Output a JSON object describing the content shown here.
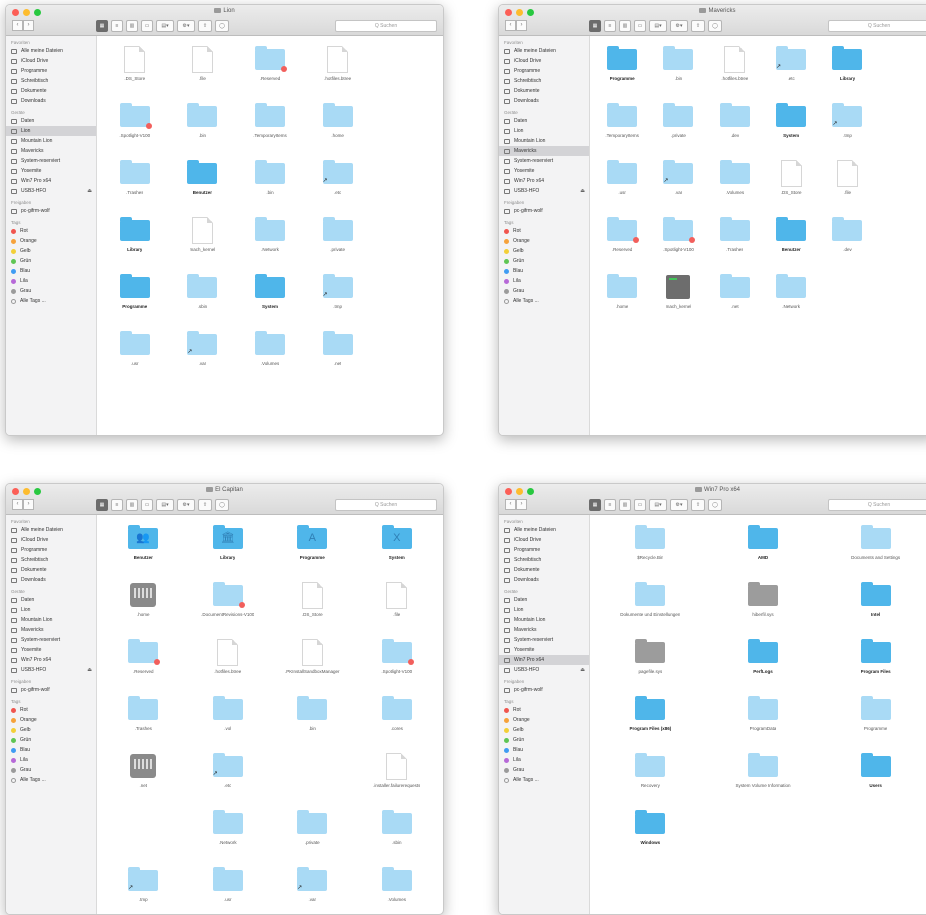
{
  "common": {
    "search_placeholder": "Q Suchen",
    "sidebar": {
      "favorites_title": "Favoriten",
      "favorites": [
        "Alle meine Dateien",
        "iCloud Drive",
        "Programme",
        "Schreibtisch",
        "Dokumente",
        "Downloads"
      ],
      "devices_title": "Geräte",
      "devices": [
        "Daten",
        "Lion",
        "Mountain Lion",
        "Mavericks",
        "System-reserviert",
        "Yosemite",
        "Win7 Pro x64",
        "USB3-HFO"
      ],
      "shared_title": "Freigaben",
      "shared": [
        "pc-gifrm-wolf"
      ],
      "tags_title": "Tags",
      "tags": [
        {
          "label": "Rot",
          "color": "#f0554e"
        },
        {
          "label": "Orange",
          "color": "#f6a23b"
        },
        {
          "label": "Gelb",
          "color": "#f3cf37"
        },
        {
          "label": "Grün",
          "color": "#5fc553"
        },
        {
          "label": "Blau",
          "color": "#3f9cf3"
        },
        {
          "label": "Lila",
          "color": "#b769d8"
        },
        {
          "label": "Grau",
          "color": "#9b9b9b"
        },
        {
          "label": "Alle Tags ...",
          "color": ""
        }
      ]
    }
  },
  "windows": [
    {
      "title": "Lion",
      "active_device": 1,
      "columns": 5,
      "items": [
        {
          "label": ".DS_Store",
          "icon": "file"
        },
        {
          "label": ".file",
          "icon": "file"
        },
        {
          "label": ".Reserved",
          "icon": "folder",
          "badge": "red"
        },
        {
          "label": ".hotfiles.btree",
          "icon": "file"
        },
        {
          "label": "",
          "icon": "none"
        },
        {
          "label": ".Spotlight-V100",
          "icon": "folder",
          "badge": "red"
        },
        {
          "label": ".bin",
          "icon": "folder"
        },
        {
          "label": ".TemporaryItems",
          "icon": "folder"
        },
        {
          "label": ".home",
          "icon": "folder"
        },
        {
          "label": "",
          "icon": "none"
        },
        {
          "label": ".Trashes",
          "icon": "folder"
        },
        {
          "label": "Benutzer",
          "icon": "folder-dark",
          "bold": true
        },
        {
          "label": ".bin",
          "icon": "folder"
        },
        {
          "label": ".etc",
          "icon": "folder",
          "badge": "alias"
        },
        {
          "label": "",
          "icon": "none"
        },
        {
          "label": "Library",
          "icon": "folder-dark",
          "bold": true
        },
        {
          "label": "mach_kernel",
          "icon": "file"
        },
        {
          "label": ".Network",
          "icon": "folder"
        },
        {
          "label": ".private",
          "icon": "folder"
        },
        {
          "label": "",
          "icon": "none"
        },
        {
          "label": "Programme",
          "icon": "folder-dark",
          "bold": true
        },
        {
          "label": ".sbin",
          "icon": "folder"
        },
        {
          "label": "System",
          "icon": "folder-dark",
          "bold": true
        },
        {
          "label": ".tmp",
          "icon": "folder",
          "badge": "alias"
        },
        {
          "label": "",
          "icon": "none"
        },
        {
          "label": ".usr",
          "icon": "folder"
        },
        {
          "label": ".var",
          "icon": "folder",
          "badge": "alias"
        },
        {
          "label": ".Volumes",
          "icon": "folder"
        },
        {
          "label": ".net",
          "icon": "folder"
        }
      ]
    },
    {
      "title": "Mavericks",
      "active_device": 3,
      "columns": 6,
      "items": [
        {
          "label": "Programme",
          "icon": "folder-dark",
          "bold": true
        },
        {
          "label": ".bin",
          "icon": "folder"
        },
        {
          "label": ".hotfiles.btree",
          "icon": "file"
        },
        {
          "label": ".etc",
          "icon": "folder",
          "badge": "alias"
        },
        {
          "label": "Library",
          "icon": "folder-dark",
          "bold": true
        },
        {
          "label": "",
          "icon": "none"
        },
        {
          "label": ".TemporaryItems",
          "icon": "folder"
        },
        {
          "label": ".private",
          "icon": "folder"
        },
        {
          "label": ".dev",
          "icon": "folder"
        },
        {
          "label": "System",
          "icon": "folder-dark",
          "bold": true
        },
        {
          "label": ".tmp",
          "icon": "folder",
          "badge": "alias"
        },
        {
          "label": "",
          "icon": "none"
        },
        {
          "label": ".usr",
          "icon": "folder"
        },
        {
          "label": ".var",
          "icon": "folder",
          "badge": "alias"
        },
        {
          "label": ".Volumes",
          "icon": "folder"
        },
        {
          "label": ".DS_Store",
          "icon": "file"
        },
        {
          "label": ".file",
          "icon": "file"
        },
        {
          "label": "",
          "icon": "none"
        },
        {
          "label": ".Reserved",
          "icon": "folder",
          "badge": "red"
        },
        {
          "label": ".Spotlight-V100",
          "icon": "folder",
          "badge": "red"
        },
        {
          "label": ".Trashes",
          "icon": "folder"
        },
        {
          "label": "Benutzer",
          "icon": "folder-dark",
          "bold": true
        },
        {
          "label": ".dev",
          "icon": "folder"
        },
        {
          "label": "",
          "icon": "none"
        },
        {
          "label": ".home",
          "icon": "folder"
        },
        {
          "label": "mach_kernel",
          "icon": "app"
        },
        {
          "label": ".net",
          "icon": "folder"
        },
        {
          "label": ".Network",
          "icon": "folder"
        }
      ]
    },
    {
      "title": "El Capitan",
      "active_device": -1,
      "columns": 4,
      "items": [
        {
          "label": "Benutzer",
          "icon": "folder-dark",
          "glyph": "👥",
          "bold": true
        },
        {
          "label": "Library",
          "icon": "folder-dark",
          "glyph": "🏛",
          "bold": true
        },
        {
          "label": "Programme",
          "icon": "folder-dark",
          "glyph": "A",
          "bold": true
        },
        {
          "label": "System",
          "icon": "folder-dark",
          "glyph": "X",
          "bold": true
        },
        {
          "label": ".home",
          "icon": "disk"
        },
        {
          "label": ".DocumentRevisions-V100",
          "icon": "folder",
          "badge": "red"
        },
        {
          "label": ".DS_Store",
          "icon": "file"
        },
        {
          "label": ".file",
          "icon": "file"
        },
        {
          "label": ".Reserved",
          "icon": "folder",
          "badge": "red"
        },
        {
          "label": ".hotfiles.btree",
          "icon": "file"
        },
        {
          "label": ".PKInstallSandboxManager",
          "icon": "file"
        },
        {
          "label": ".Spotlight-V100",
          "icon": "folder",
          "badge": "red"
        },
        {
          "label": ".Trashes",
          "icon": "folder"
        },
        {
          "label": ".vol",
          "icon": "folder"
        },
        {
          "label": ".bin",
          "icon": "folder"
        },
        {
          "label": ".cores",
          "icon": "folder"
        },
        {
          "label": ".net",
          "icon": "disk"
        },
        {
          "label": ".etc",
          "icon": "folder",
          "badge": "alias"
        },
        {
          "label": "",
          "icon": "none"
        },
        {
          "label": ".installer.failurerequests",
          "icon": "file"
        },
        {
          "label": "",
          "icon": "none"
        },
        {
          "label": ".Network",
          "icon": "folder"
        },
        {
          "label": ".private",
          "icon": "folder"
        },
        {
          "label": ".sbin",
          "icon": "folder"
        },
        {
          "label": ".tmp",
          "icon": "folder",
          "badge": "alias"
        },
        {
          "label": ".usr",
          "icon": "folder"
        },
        {
          "label": ".var",
          "icon": "folder",
          "badge": "alias"
        },
        {
          "label": ".Volumes",
          "icon": "folder"
        }
      ]
    },
    {
      "title": "Win7 Pro x64",
      "active_device": 6,
      "columns": 3,
      "items": [
        {
          "label": "$Recycle.Bin",
          "icon": "folder"
        },
        {
          "label": "AMD",
          "icon": "folder-dark",
          "bold": true
        },
        {
          "label": "Documents and Settings",
          "icon": "folder"
        },
        {
          "label": "Dokumente und Einstellungen",
          "icon": "folder"
        },
        {
          "label": "hiberfil.sys",
          "icon": "folder-gray"
        },
        {
          "label": "Intel",
          "icon": "folder-dark",
          "bold": true
        },
        {
          "label": "pagefile.sys",
          "icon": "folder-gray"
        },
        {
          "label": "PerfLogs",
          "icon": "folder-dark",
          "bold": true
        },
        {
          "label": "Program Files",
          "icon": "folder-dark",
          "bold": true
        },
        {
          "label": "Program Files (x86)",
          "icon": "folder-dark",
          "bold": true
        },
        {
          "label": "ProgramData",
          "icon": "folder"
        },
        {
          "label": "Programme",
          "icon": "folder"
        },
        {
          "label": "Recovery",
          "icon": "folder"
        },
        {
          "label": "System Volume Information",
          "icon": "folder"
        },
        {
          "label": "Users",
          "icon": "folder-dark",
          "bold": true
        },
        {
          "label": "Windows",
          "icon": "folder-dark",
          "bold": true
        }
      ]
    }
  ]
}
